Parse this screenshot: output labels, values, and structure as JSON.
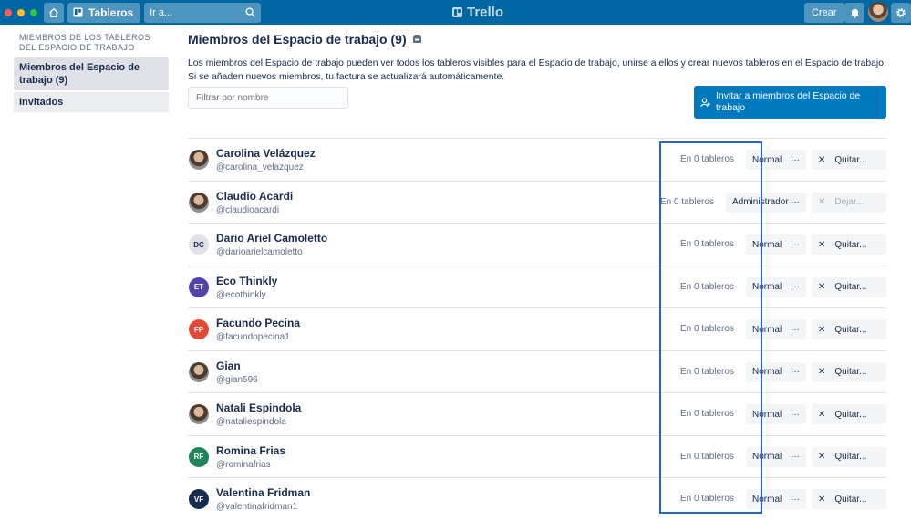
{
  "header": {
    "traffic_colors": [
      "#ff5f57",
      "#febc2e",
      "#28c840"
    ],
    "boards_label": "Tableros",
    "search_placeholder": "Ir a...",
    "logo_text": "Trello",
    "create_label": "Crear",
    "icons": {
      "home": "home-icon",
      "boards": "boards-icon",
      "search": "search-icon",
      "bell": "bell-icon",
      "gear": "gear-icon"
    }
  },
  "sidebar": {
    "section_title": "MIEMBROS DE LOS TABLEROS DEL ESPACIO DE TRABAJO",
    "items": [
      {
        "label": "Miembros del Espacio de trabajo (9)",
        "active": true
      },
      {
        "label": "Invitados",
        "active": false
      }
    ]
  },
  "main": {
    "title": "Miembros del Espacio de trabajo (9)",
    "description": "Los miembros del Espacio de trabajo pueden ver todos los tableros visibles para el Espacio de trabajo, unirse a ellos y crear nuevos tableros en el Espacio de trabajo. Si se añaden nuevos miembros, tu factura se actualizará automáticamente.",
    "filter_placeholder": "Filtrar por nombre",
    "invite_label": "Invitar a miembros del Espacio de trabajo"
  },
  "members": [
    {
      "name": "Carolina Velázquez",
      "handle": "@carolina_velazquez",
      "initials": "",
      "avatar_color": "",
      "boards": "En 0 tableros",
      "role": "Normal",
      "action": "Quitar...",
      "admin": false
    },
    {
      "name": "Claudio Acardi",
      "handle": "@claudioacardi",
      "initials": "",
      "avatar_color": "",
      "boards": "En 0 tableros",
      "role": "Administrador",
      "action": "Dejar...",
      "admin": true
    },
    {
      "name": "Dario Ariel Camoletto",
      "handle": "@darioarielcamoletto",
      "initials": "DC",
      "avatar_color": "#dfe1e6",
      "boards": "En 0 tableros",
      "role": "Normal",
      "action": "Quitar...",
      "admin": false
    },
    {
      "name": "Eco Thinkly",
      "handle": "@ecothinkly",
      "initials": "ET",
      "avatar_color": "#5243aa",
      "boards": "En 0 tableros",
      "role": "Normal",
      "action": "Quitar...",
      "admin": false
    },
    {
      "name": "Facundo Pecina",
      "handle": "@facundopecina1",
      "initials": "FP",
      "avatar_color": "#e34935",
      "boards": "En 0 tableros",
      "role": "Normal",
      "action": "Quitar...",
      "admin": false
    },
    {
      "name": "Gian",
      "handle": "@gian596",
      "initials": "",
      "avatar_color": "",
      "boards": "En 0 tableros",
      "role": "Normal",
      "action": "Quitar...",
      "admin": false
    },
    {
      "name": "Natali Espindola",
      "handle": "@nataliespindola",
      "initials": "",
      "avatar_color": "",
      "boards": "En 0 tableros",
      "role": "Normal",
      "action": "Quitar...",
      "admin": false
    },
    {
      "name": "Romina Frias",
      "handle": "@rominafrias",
      "initials": "RF",
      "avatar_color": "#1f845a",
      "boards": "En 0 tableros",
      "role": "Normal",
      "action": "Quitar...",
      "admin": false
    },
    {
      "name": "Valentina Fridman",
      "handle": "@valentinafridman1",
      "initials": "VF",
      "avatar_color": "#172b4d",
      "boards": "En 0 tableros",
      "role": "Normal",
      "action": "Quitar...",
      "admin": false
    }
  ],
  "highlight_color": "#2266d6"
}
